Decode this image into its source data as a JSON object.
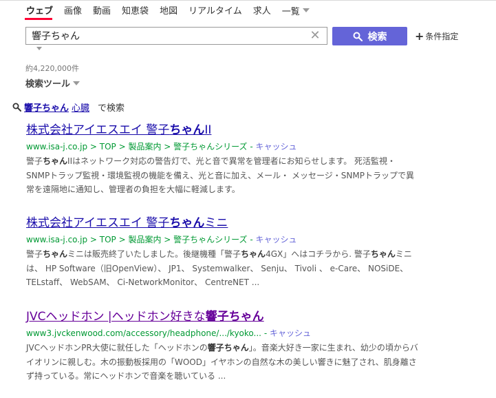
{
  "nav": {
    "tabs": [
      "ウェブ",
      "画像",
      "動画",
      "知恵袋",
      "地図",
      "リアルタイム",
      "求人"
    ],
    "more_label": "一覧"
  },
  "search": {
    "query": "響子ちゃん",
    "button_label": "検索",
    "conditions_label": "条件指定"
  },
  "result_count": "約4,220,000件",
  "tools_label": "検索ツール",
  "suggestion": {
    "term1": "響子ちゃん",
    "term2": "心臓",
    "suffix": "で検索"
  },
  "results": [
    {
      "title_pre": "株式会社アイエスエイ 警子",
      "title_bold": "ちゃん",
      "title_post": "II",
      "url": "www.isa-j.co.jp > TOP > 製品案内 > 警子ちゃんシリーズ",
      "cache": "キャッシュ",
      "desc_parts": [
        {
          "t": "警子"
        },
        {
          "t": "ちゃん",
          "b": true
        },
        {
          "t": "IIはネットワーク対応の警告灯で、光と音で異常を管理者にお知らせします。 死活監視・SNMPトラップ監視・環境監視の機能を備え、光と音に加え、メール・ メッセージ・SNMPトラップで異常を遠隔地に通知し、管理者の負担を大幅に軽減します。"
        }
      ]
    },
    {
      "title_pre": "株式会社アイエスエイ 警子",
      "title_bold": "ちゃん",
      "title_post": "ミニ",
      "url": "www.isa-j.co.jp > TOP > 製品案内 > 警子ちゃんシリーズ",
      "cache": "キャッシュ",
      "desc_parts": [
        {
          "t": "警子"
        },
        {
          "t": "ちゃん",
          "b": true
        },
        {
          "t": "ミニは販売終了いたしました。後継機種「警子"
        },
        {
          "t": "ちゃん",
          "b": true
        },
        {
          "t": "4GX」へはコチラから. 警子"
        },
        {
          "t": "ちゃん",
          "b": true
        },
        {
          "t": "ミニは、 HP Software（旧OpenView）、 JP1、 Systemwalker、 Senju、 Tivoli 、 e-Care、 NOSiDE、 TELstaff、 WebSAM、 Ci-NetworkMonitor、 CentreNET ..."
        }
      ]
    },
    {
      "title_pre": "JVCヘッドホン |ヘッドホン好きな",
      "title_bold": "響子ちゃん",
      "title_post": "",
      "url": "www3.jvckenwood.com/accessory/headphone/.../kyoko...",
      "cache": "キャッシュ",
      "desc_parts": [
        {
          "t": "JVCヘッドホンPR大使に就任した「ヘッドホンの"
        },
        {
          "t": "響子ちゃん",
          "b": true
        },
        {
          "t": "」。音楽大好き一家に生まれ、幼少の頃からバイオリンに親しむ。木の振動板採用の「WOOD」イヤホンの自然な木の美しい響きに魅了され、肌身離さず持っている。常にヘッドホンで音楽を聴いている ..."
        }
      ]
    }
  ],
  "colors": {
    "link": "#1a0dab",
    "visited": "#660099",
    "url": "#009933",
    "button": "#6464d8",
    "accent": "#ff0033"
  }
}
